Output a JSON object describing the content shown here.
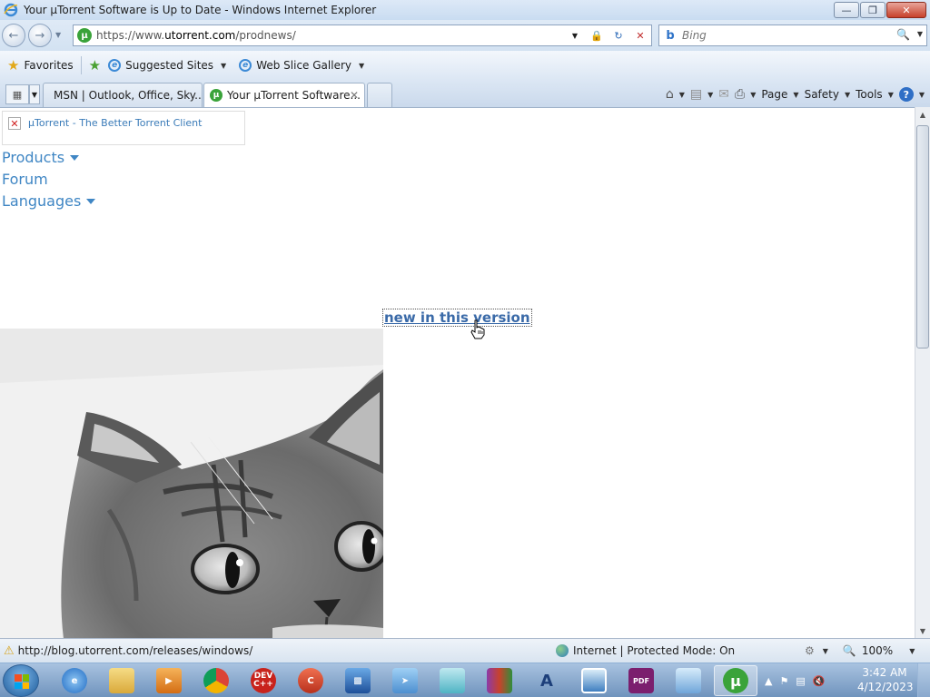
{
  "window": {
    "title": "Your µTorrent Software is Up to Date - Windows Internet Explorer"
  },
  "address_bar": {
    "url_prefix": "https://www.",
    "url_domain": "utorrent.com",
    "url_path": "/prodnews/"
  },
  "search": {
    "placeholder": "Bing"
  },
  "favorites_bar": {
    "favorites_label": "Favorites",
    "suggested_sites": "Suggested Sites",
    "web_slice_gallery": "Web Slice Gallery"
  },
  "tabs": [
    {
      "label": "MSN | Outlook, Office, Sky...",
      "active": false
    },
    {
      "label": "Your µTorrent Software...",
      "active": true
    }
  ],
  "command_bar": {
    "page": "Page",
    "safety": "Safety",
    "tools": "Tools"
  },
  "content": {
    "broken_image_alt": "µTorrent - The Better Torrent Client",
    "menu": {
      "products": "Products",
      "forum": "Forum",
      "languages": "Languages"
    },
    "new_version_link": "new in this version"
  },
  "status_bar": {
    "url": "http://blog.utorrent.com/releases/windows/",
    "zone": "Internet | Protected Mode: On",
    "zoom": "100%"
  },
  "taskbar": {
    "items": [
      {
        "name": "internet-explorer",
        "label": ""
      },
      {
        "name": "windows-explorer",
        "label": ""
      },
      {
        "name": "media-player",
        "label": ""
      },
      {
        "name": "chrome",
        "label": ""
      },
      {
        "name": "dev-cpp",
        "label": "DEV C++"
      },
      {
        "name": "ccleaner",
        "label": ""
      },
      {
        "name": "remote-desktop",
        "label": ""
      },
      {
        "name": "mail-app",
        "label": ""
      },
      {
        "name": "notes-app",
        "label": ""
      },
      {
        "name": "winrar",
        "label": ""
      },
      {
        "name": "graphics-app",
        "label": ""
      },
      {
        "name": "photo-viewer",
        "label": ""
      },
      {
        "name": "pdf-app",
        "label": "PDF"
      },
      {
        "name": "control-panel",
        "label": ""
      },
      {
        "name": "utorrent",
        "label": ""
      }
    ],
    "clock_time": "3:42 AM",
    "clock_date": "4/12/2023"
  },
  "colors": {
    "link_blue": "#3f86c4",
    "utorrent_green": "#3aa33a"
  }
}
